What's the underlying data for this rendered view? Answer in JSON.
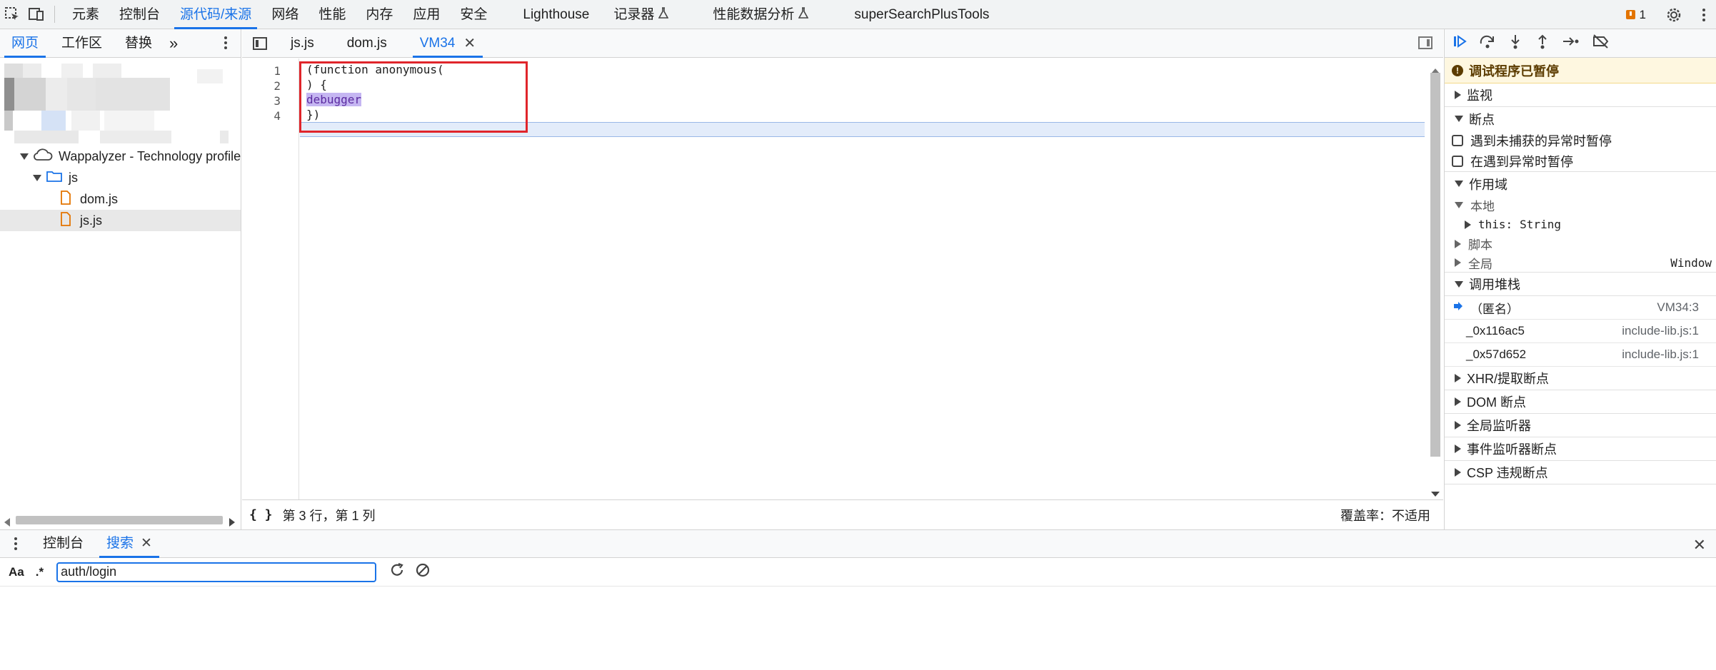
{
  "toolbar": {
    "tabs": [
      {
        "label": "元素"
      },
      {
        "label": "控制台"
      },
      {
        "label": "源代码/来源"
      },
      {
        "label": "网络"
      },
      {
        "label": "性能"
      },
      {
        "label": "内存"
      },
      {
        "label": "应用"
      },
      {
        "label": "安全"
      },
      {
        "label": "Lighthouse"
      },
      {
        "label": "记录器"
      },
      {
        "label": "性能数据分析"
      },
      {
        "label": "superSearchPlusTools"
      }
    ],
    "issues_count": "1",
    "accent_color": "#1a73e8"
  },
  "navigator": {
    "tabs": [
      {
        "label": "网页"
      },
      {
        "label": "工作区"
      },
      {
        "label": "替换"
      }
    ],
    "tree": {
      "extension": "Wappalyzer - Technology profiler",
      "folder": "js",
      "files": [
        "dom.js",
        "js.js"
      ]
    }
  },
  "editor": {
    "tabs": [
      {
        "label": "js.js"
      },
      {
        "label": "dom.js"
      },
      {
        "label": "VM34"
      }
    ],
    "lines": [
      {
        "no": "1",
        "text": "(function anonymous("
      },
      {
        "no": "2",
        "text": ") {"
      },
      {
        "no": "3",
        "text": "debugger"
      },
      {
        "no": "4",
        "text": "})"
      }
    ],
    "status": {
      "position": "第 3 行，第 1 列",
      "coverage": "覆盖率：不适用"
    }
  },
  "debugger": {
    "paused_banner": "调试程序已暂停",
    "sections": {
      "watch": "监视",
      "breakpoints": "断点",
      "scope": "作用域",
      "callstack": "调用堆栈",
      "xhr": "XHR/提取断点",
      "dom": "DOM 断点",
      "global_listeners": "全局监听器",
      "event_listeners": "事件监听器断点",
      "csp": "CSP 违规断点"
    },
    "breakpoint_options": [
      {
        "label": "遇到未捕获的异常时暂停"
      },
      {
        "label": "在遇到异常时暂停"
      }
    ],
    "scope": {
      "local": "本地",
      "this_label": "this",
      "this_value": "String",
      "script": "脚本",
      "global": "全局",
      "global_value": "Window"
    },
    "call_stack": [
      {
        "name": "（匿名）",
        "location": "VM34:3"
      },
      {
        "name": "_0x116ac5",
        "location": "include-lib.js:1"
      },
      {
        "name": "_0x57d652",
        "location": "include-lib.js:1"
      }
    ]
  },
  "drawer": {
    "tabs": [
      {
        "label": "控制台"
      },
      {
        "label": "搜索"
      }
    ],
    "match_case": "Aa",
    "regex": ".*",
    "search_value": "auth/login"
  }
}
